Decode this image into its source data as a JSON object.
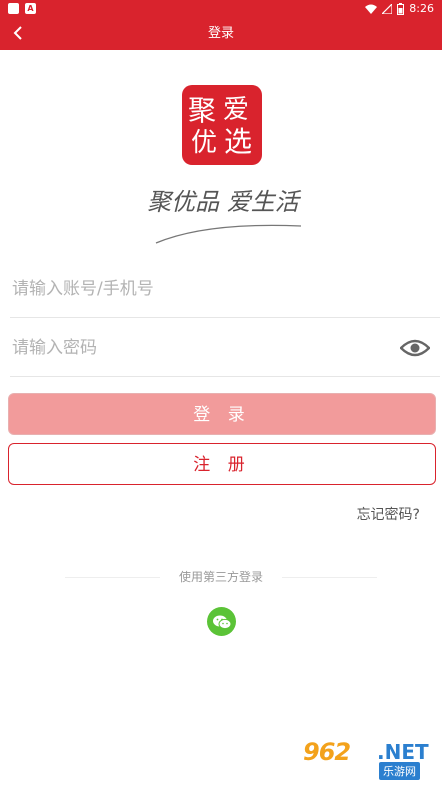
{
  "status_bar": {
    "time": "8:26",
    "app_icon_letter": "A"
  },
  "nav": {
    "title": "登录",
    "back_icon": "chevron-left-icon"
  },
  "brand": {
    "logo_chars": [
      "聚",
      "爱",
      "优",
      "选"
    ],
    "slogan": "聚优品 爱生活",
    "accent_color": "#d9232d"
  },
  "form": {
    "account_placeholder": "请输入账号/手机号",
    "account_value": "",
    "password_placeholder": "请输入密码",
    "password_value": ""
  },
  "buttons": {
    "login_label": "登 录",
    "register_label": "注 册",
    "forgot_label": "忘记密码?"
  },
  "third_party": {
    "label": "使用第三方登录",
    "wechat_icon": "wechat-icon"
  },
  "watermark": {
    "num": "962",
    "net": ".NET",
    "sub": "乐游网"
  }
}
